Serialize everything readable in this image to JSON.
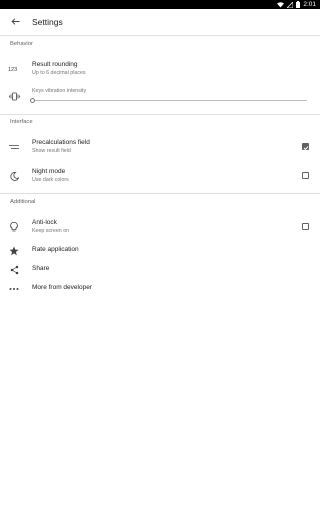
{
  "status_bar": {
    "time": "2:01",
    "icons": [
      "wifi-icon",
      "no-signal-icon",
      "battery-icon"
    ]
  },
  "app_bar": {
    "back_icon": "arrow-back-icon",
    "title": "Settings"
  },
  "sections": {
    "behavior": {
      "header": "Behavior",
      "result_rounding": {
        "icon": "123-icon",
        "title": "Result rounding",
        "subtitle": "Up to 6 decimal places"
      },
      "vibration": {
        "icon": "vibration-icon",
        "label": "Keys vibration intensity",
        "value": 0
      }
    },
    "interface": {
      "header": "Interface",
      "precalculations": {
        "icon": "short-text-icon",
        "title": "Precalculations field",
        "subtitle": "Show result field",
        "checked": true
      },
      "night_mode": {
        "icon": "moon-icon",
        "title": "Night mode",
        "subtitle": "Use dark colors",
        "checked": false
      }
    },
    "additional": {
      "header": "Additional",
      "anti_lock": {
        "icon": "lightbulb-icon",
        "title": "Anti-lock",
        "subtitle": "Keep screen on",
        "checked": false
      },
      "rate": {
        "icon": "star-icon",
        "title": "Rate application"
      },
      "share": {
        "icon": "share-icon",
        "title": "Share"
      },
      "more": {
        "icon": "more-dots-icon",
        "title": "More from developer"
      }
    }
  },
  "colors": {
    "status_bar": "#000000",
    "divider": "#e0e0e0",
    "checkbox": "#616161"
  }
}
